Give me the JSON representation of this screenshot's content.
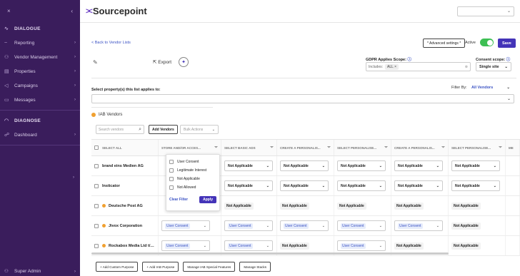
{
  "sidebar": {
    "close_glyph": "×",
    "collapse_glyph": "‹",
    "sections": {
      "dialogue": "DIALOGUE",
      "diagnose": "DIAGNOSE"
    },
    "dialogue_items": [
      {
        "label": "Reporting",
        "icon": "~"
      },
      {
        "label": "Vendor Management",
        "icon": "⚇"
      },
      {
        "label": "Properties",
        "icon": "▤"
      },
      {
        "label": "Campaigns",
        "icon": "◁"
      },
      {
        "label": "Messages",
        "icon": "▭"
      }
    ],
    "diagnose_items": [
      {
        "label": "Dashboard",
        "icon": "☍"
      }
    ],
    "chevron": "›",
    "bottom_user": "Super Admin"
  },
  "topbar": {
    "brand": "Sourcepoint",
    "select_chevron": "⌄"
  },
  "header": {
    "back_link": "< Back to Vendor Lists",
    "advanced_settings": "* Advanced settings *",
    "active_label": "Active",
    "save_label": "Save",
    "export_label": "Export",
    "gdpr_label": "GDPR Applies Scope:",
    "gdpr_includes": "Includes:",
    "gdpr_chip": "ALL ×",
    "consent_scope_label": "Consent scope:",
    "consent_scope_value": "Single site",
    "info_glyph": "ⓘ"
  },
  "properties": {
    "label": "Select property(s) this list applies to:",
    "filter_label": "Filter By:",
    "filter_value": "All Vendors"
  },
  "iab": {
    "title": "IAB Vendors",
    "search_placeholder": "Search vendors",
    "add_vendors": "Add Vendors",
    "bulk_actions": "Bulk Actions"
  },
  "table": {
    "headers": [
      "SELECT ALL",
      "STORE AND/OR ACCES...",
      "SELECT BASIC ADS",
      "CREATE A PERSONALIS...",
      "SELECT PERSONALISE...",
      "CREATE A PERSONALIS...",
      "SELECT PERSONALISE...",
      "ME"
    ],
    "rows": [
      {
        "name": "brand eins Medien AG",
        "dot": false,
        "c1": "",
        "c2": "Not Applicable",
        "c3": "Not Applicable",
        "c4": "Not Applicable",
        "c5": "Not Applicable",
        "c6": "Not Applicable"
      },
      {
        "name": "Insticator",
        "dot": false,
        "c1": "",
        "c2": "Not Applicable",
        "c3": "Not Applicable",
        "c4": "Not Applicable",
        "c5": "Not Applicable",
        "c6": "Not Applicable"
      },
      {
        "name": "Deutsche Post AG",
        "dot": true,
        "c1": "",
        "c2": "Not Applicable",
        "c3": "Not Applicable",
        "c4": "Not Applicable",
        "c5": "Not Applicable",
        "c6": "Not Applicable"
      },
      {
        "name": "Jivox Corporation",
        "dot": true,
        "c1": "User Consent",
        "c2": "User Consent",
        "c3": "User Consent",
        "c4": "User Consent",
        "c5": "User Consent",
        "c6": "Not Applicable"
      },
      {
        "name": "Rockabox Media Ltd t/a S...",
        "dot": true,
        "c1": "User Consent",
        "c2": "User Consent",
        "c3": "Not Applicable",
        "c4": "User Consent",
        "c5": "Not Applicable",
        "c6": "Not Applicable"
      }
    ]
  },
  "filter_popup": {
    "options": [
      "User Consent",
      "Legitimate Interest",
      "Not Applicable",
      "Not Allowed"
    ],
    "clear_label": "Clear Filter",
    "apply_label": "Apply"
  },
  "bottom_buttons": [
    "+ Add Custom Purpose",
    "+ Add IAB Purpose",
    "Manage IAB Special Features",
    "Manage Stacks"
  ],
  "glyphs": {
    "chevron_down": "⌄",
    "filter": "⏷",
    "search": "⌕",
    "pencil": "✎",
    "export": "⇱",
    "wand": "✦",
    "clear": "⊗"
  }
}
